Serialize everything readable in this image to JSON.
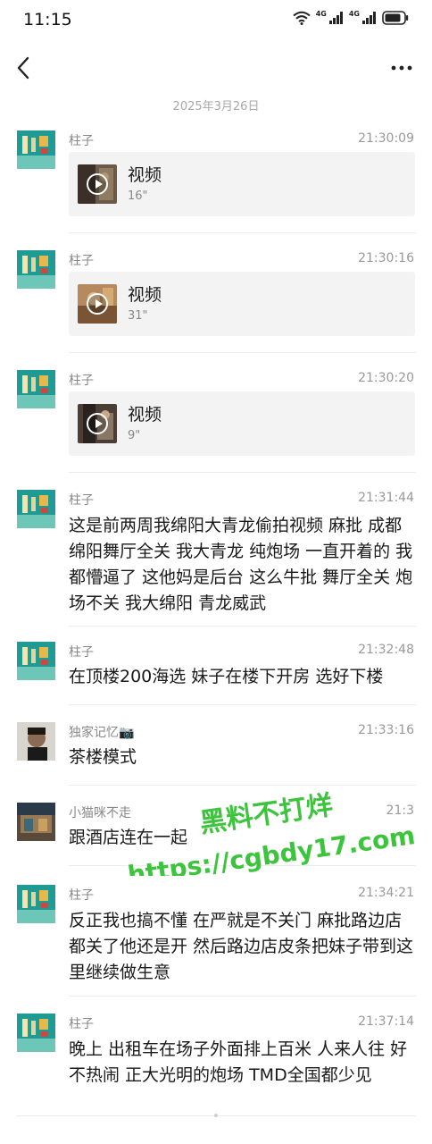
{
  "status_bar": {
    "time": "11:15",
    "network_1": "4G",
    "network_2": "4G"
  },
  "date_separator": "2025年3月26日",
  "messages": [
    {
      "sender": "柱子",
      "time": "21:30:09",
      "video": {
        "title": "视频",
        "duration": "16\""
      }
    },
    {
      "sender": "柱子",
      "time": "21:30:16",
      "video": {
        "title": "视频",
        "duration": "31\""
      }
    },
    {
      "sender": "柱子",
      "time": "21:30:20",
      "video": {
        "title": "视频",
        "duration": "9\""
      }
    },
    {
      "sender": "柱子",
      "time": "21:31:44",
      "text": "这是前两周我绵阳大青龙偷拍视频 麻批 成都 绵阳舞厅全关 我大青龙 纯炮场 一直开着的 我都懵逼了 这他妈是后台 这么牛批 舞厅全关 炮场不关 我大绵阳 青龙威武"
    },
    {
      "sender": "柱子",
      "time": "21:32:48",
      "text": "在顶楼200海选  妹子在楼下开房 选好下楼"
    },
    {
      "sender": "独家记忆📷",
      "time": "21:33:16",
      "text": "茶楼模式"
    },
    {
      "sender": "小猫咪不走",
      "time": "21:3",
      "text": "跟酒店连在一起"
    },
    {
      "sender": "柱子",
      "time": "21:34:21",
      "text": "反正我也搞不懂 在严就是不关门  麻批路边店都关了他还是开 然后路边店皮条把妹子带到这里继续做生意"
    },
    {
      "sender": "柱子",
      "time": "21:37:14",
      "text": "晚上 出租车在场子外面排上百米 人来人往 好不热闹 正大光明的炮场 TMD全国都少见"
    }
  ],
  "watermark": {
    "line1": "黑料不打烊",
    "line2": "https://cgbdy17.com",
    "color": "#3cc43c"
  },
  "icons": {
    "back": "chevron-left-icon",
    "more": "more-dots-icon",
    "wifi": "wifi-icon",
    "battery": "battery-icon",
    "play": "play-icon"
  }
}
